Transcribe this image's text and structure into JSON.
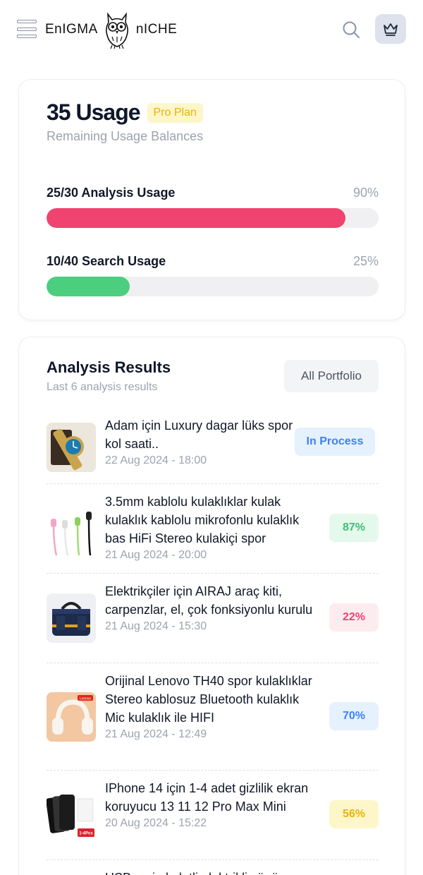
{
  "header": {
    "logo_left": "EnIGMA",
    "logo_right": "nICHE",
    "icons": {
      "menu": "menu-icon",
      "owl": "owl-logo-icon",
      "search": "search-icon",
      "crown": "crown-icon"
    }
  },
  "usage": {
    "title": "35 Usage",
    "plan_badge": "Pro Plan",
    "subtitle": "Remaining Usage Balances",
    "meters": [
      {
        "label": "25/30 Analysis Usage",
        "percent_label": "90%",
        "fill_fraction": 0.9,
        "color": "#f0436f"
      },
      {
        "label": "10/40 Search Usage",
        "percent_label": "25%",
        "fill_fraction": 0.25,
        "color": "#4bcf7f"
      }
    ]
  },
  "results": {
    "title": "Analysis Results",
    "subtitle": "Last 6 analysis results",
    "portfolio_button": "All Portfolio",
    "items": [
      {
        "title": "Adam için Luxury dagar lüks spor kol saati..",
        "date": "22 Aug 2024 - 18:00",
        "status": "In Process",
        "status_color": "#3b82f6",
        "status_bg": "#e6f1fe",
        "thumb": "watch-thumbnail"
      },
      {
        "title": "3.5mm kablolu kulaklıklar kulak kulaklık kablolu mikrofonlu kulaklık bas HiFi Stereo kulakiçi spor",
        "date": "21 Aug 2024 - 20:00",
        "status": "87%",
        "status_color": "#3fbf74",
        "status_bg": "#e5f8ec",
        "thumb": "earphones-thumbnail"
      },
      {
        "title": "Elektrikçiler için AIRAJ araç kiti, carpenzlar, el, çok fonksiyonlu kurulu",
        "date": "21 Aug 2024 - 15:30",
        "status": "22%",
        "status_color": "#f0436f",
        "status_bg": "#fdecef",
        "thumb": "tool-bag-thumbnail"
      },
      {
        "title": "Orijinal Lenovo TH40 spor kulaklıklar Stereo kablosuz Bluetooth kulaklık Mic kulaklık ile HIFI",
        "date": "21 Aug 2024 - 12:49",
        "status": "70%",
        "status_color": "#3b82f6",
        "status_bg": "#e6f1fe",
        "thumb": "headphones-thumbnail",
        "thumb_label": "Lenovo"
      },
      {
        "title": "IPhone 14 için 1-4 adet gizlilik ekran koruyucu 13 11 12 Pro Max Mini",
        "date": "20 Aug 2024 - 15:22",
        "status": "56%",
        "status_color": "#eab308",
        "status_bg": "#fdf6c8",
        "thumb": "screen-protector-thumbnail",
        "thumb_label": "1-4Pcs"
      },
      {
        "title": "USB şarj el aletli elektrikli süpürge",
        "date": "",
        "status": "",
        "thumb": ""
      }
    ]
  }
}
